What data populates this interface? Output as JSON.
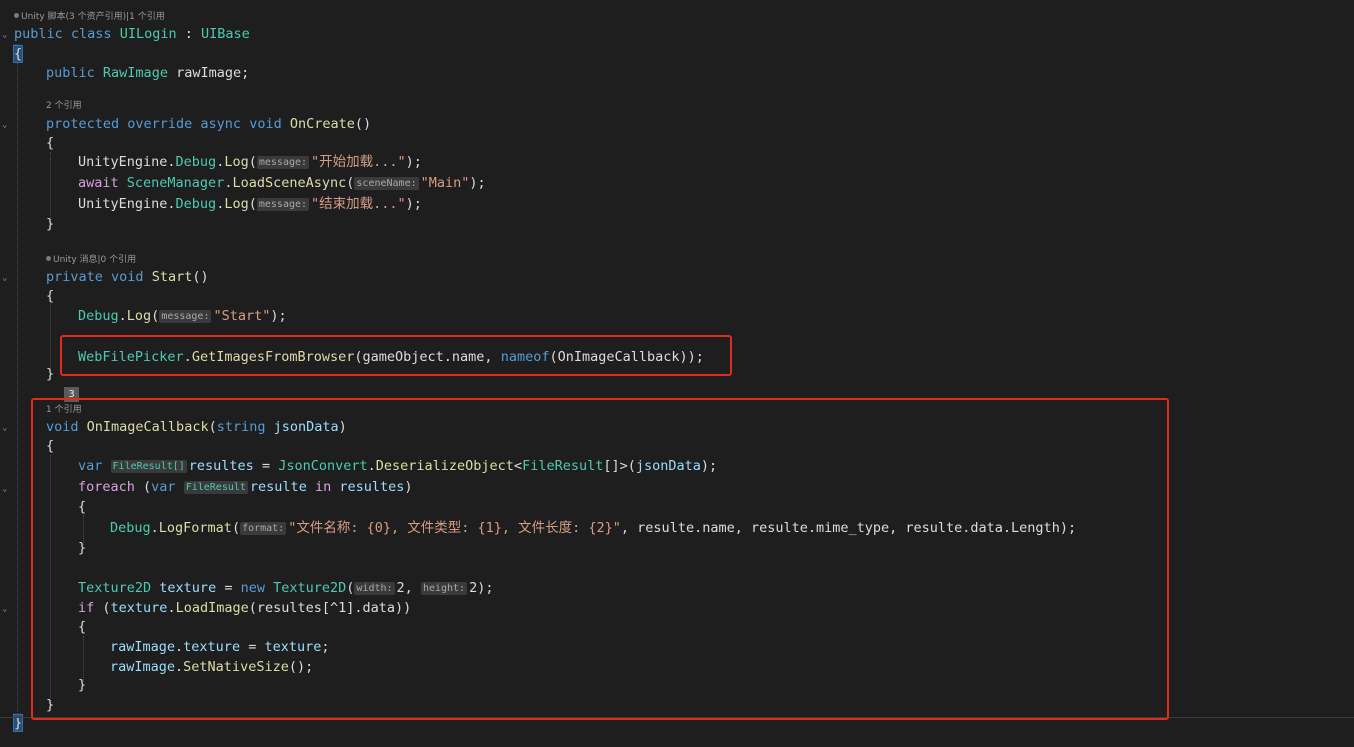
{
  "codelens": {
    "class_refs": "Unity 脚本(3 个资产引用)|1 个引用",
    "oncreate_refs": "2 个引用",
    "start_refs": "Unity 消息|0 个引用",
    "callback_refs": "1 个引用"
  },
  "overlay_badge": "3",
  "hints": {
    "message": "message:",
    "sceneName": "sceneName:",
    "format": "format:",
    "width": "width:",
    "height": "height:",
    "file_result": "FileResult",
    "file_result_array": "FileResult[]"
  },
  "code": {
    "class_decl_pub": "public",
    "class_decl_class": "class",
    "class_name": "UILogin",
    "class_colon": " : ",
    "class_base": "UIBase",
    "field_pub": "public",
    "field_type": "RawImage",
    "field_name": "rawImage;",
    "oncreate_mods": "protected override async void",
    "oncreate_name": "OnCreate",
    "oncreate_parens": "()",
    "log1_ns": "UnityEngine.",
    "debug": "Debug",
    "log": "Log",
    "log1_str": "\"开始加载...\"",
    "await": "await",
    "scenemgr": "SceneManager",
    "loadscene": "LoadSceneAsync",
    "scene_str": "\"Main\"",
    "log3_str": "\"结束加载...\"",
    "start_mods": "private void",
    "start_name": "Start",
    "start_str": "\"Start\"",
    "webpicker": "WebFilePicker",
    "getimages": "GetImagesFromBrowser",
    "getimages_args1": "(gameObject.name, ",
    "nameof": "nameof",
    "getimages_args2": "(OnImageCallback));",
    "cb_void": "void",
    "cb_name": "OnImageCallback",
    "cb_string": "string",
    "cb_param": "jsonData",
    "var": "var",
    "resultes": "resultes",
    "jsonconvert": "JsonConvert",
    "deserialize": "DeserializeObject",
    "fileresult": "FileResult",
    "jsondata": "jsonData",
    "foreach": "foreach",
    "resulte": "resulte",
    "in": "in",
    "logformat": "LogFormat",
    "format_str": "\"文件名称: {0}, 文件类型: {1}, 文件长度: {2}\"",
    "format_args": ", resulte.name, resulte.mime_type, resulte.data.Length);",
    "texture2d": "Texture2D",
    "texture": "texture",
    "new": "new",
    "if": "if",
    "loadimage": "LoadImage",
    "loadimage_arg": "(resultes[^1].data))",
    "rawimage": "rawImage",
    "setnative": "SetNativeSize"
  }
}
